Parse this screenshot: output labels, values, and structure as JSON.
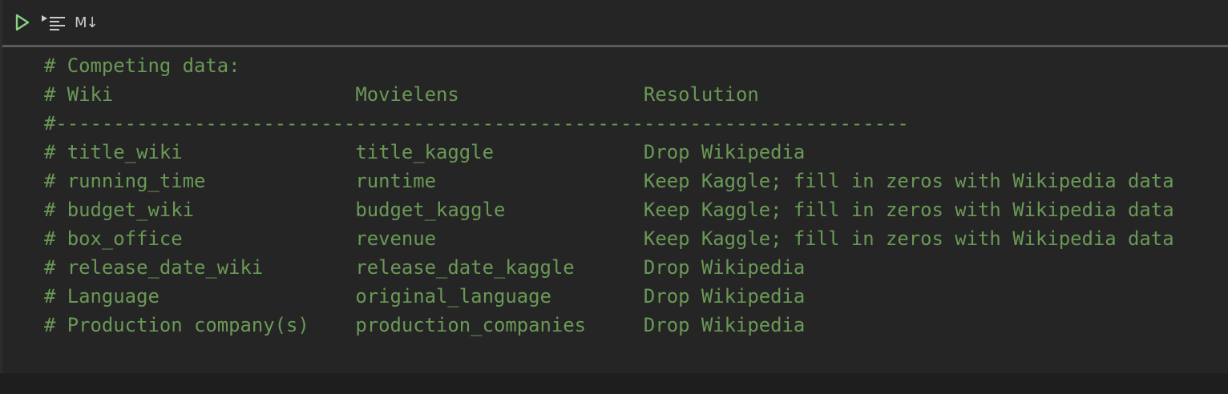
{
  "toolbar": {
    "run_icon": "play-icon",
    "run_by_line_icon": "run-by-line-icon",
    "markdown_label": "M↓",
    "colors": {
      "run": "#89d185",
      "icon": "#cccccc"
    }
  },
  "code": {
    "color": "#6a9955",
    "lines": [
      "# Competing data:",
      "# Wiki                     Movielens                Resolution",
      "#--------------------------------------------------------------------------",
      "# title_wiki               title_kaggle             Drop Wikipedia",
      "# running_time             runtime                  Keep Kaggle; fill in zeros with Wikipedia data",
      "# budget_wiki              budget_kaggle            Keep Kaggle; fill in zeros with Wikipedia data",
      "# box_office               revenue                  Keep Kaggle; fill in zeros with Wikipedia data",
      "# release_date_wiki        release_date_kaggle      Drop Wikipedia",
      "# Language                 original_language        Drop Wikipedia",
      "# Production company(s)    production_companies     Drop Wikipedia"
    ]
  }
}
